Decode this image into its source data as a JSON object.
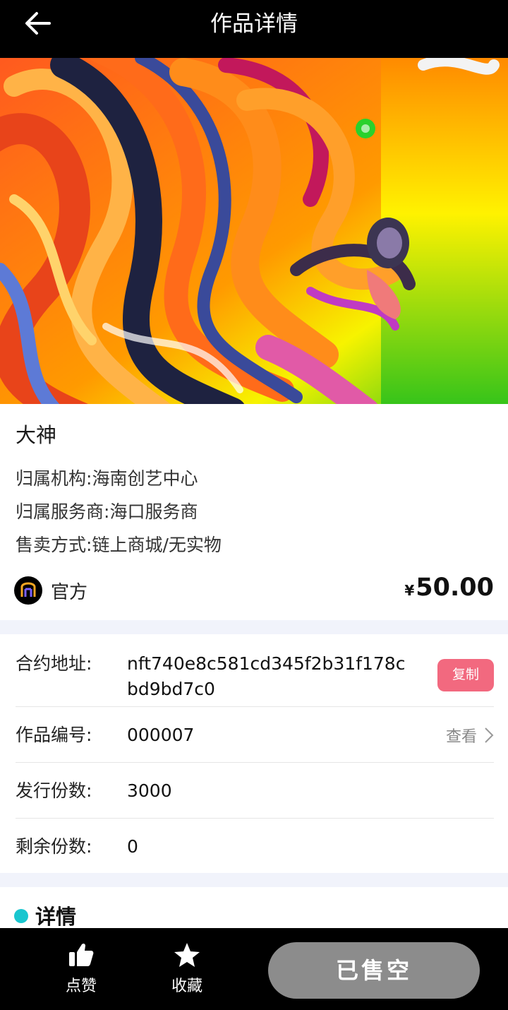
{
  "header": {
    "title": "作品详情",
    "back_icon": "arrow-left-icon"
  },
  "artwork": {
    "description_icon": "nft-artwork-image"
  },
  "info": {
    "name": "大神",
    "institution_label": "归属机构:",
    "institution_value": "海南创艺中心",
    "provider_label": "归属服务商:",
    "provider_value": "海口服务商",
    "sale_label": "售卖方式:",
    "sale_value": "链上商城/无实物",
    "creator_name": "官方",
    "price_symbol": "¥",
    "price_value": "50.00"
  },
  "details": {
    "contract_label": "合约地址:",
    "contract_value": "nft740e8c581cd345f2b31f178cbd9bd7c0",
    "copy_label": "复制",
    "work_no_label": "作品编号:",
    "work_no_value": "000007",
    "view_label": "查看",
    "issued_label": "发行份数:",
    "issued_value": "3000",
    "remaining_label": "剩余份数:",
    "remaining_value": "0"
  },
  "section": {
    "title": "详情"
  },
  "bottom_bar": {
    "like_label": "点赞",
    "favorite_label": "收藏",
    "status_label": "已售空"
  },
  "colors": {
    "header_bg": "#000000",
    "copy_button": "#f2697f",
    "section_dot": "#19c6cf",
    "soldout_button": "#8c8c8c",
    "page_bg": "#f1f3fb"
  }
}
